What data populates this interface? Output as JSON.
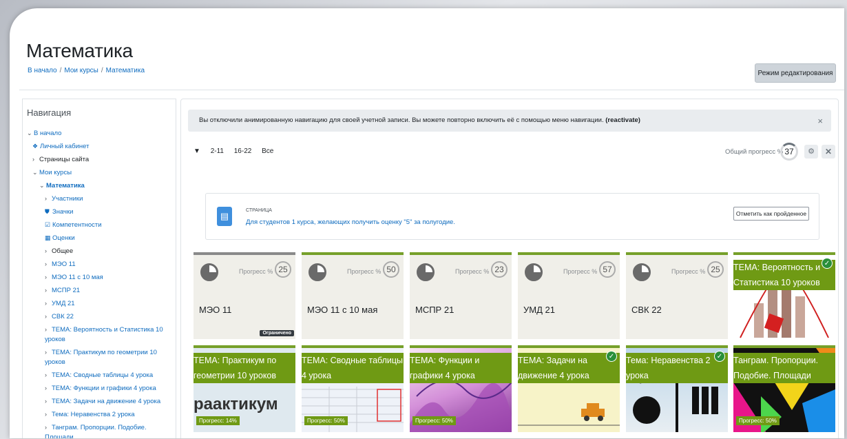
{
  "page_title": "Математика",
  "breadcrumb": [
    "В начало",
    "Мои курсы",
    "Математика"
  ],
  "breadcrumb_sep": "/",
  "edit_button": "Режим редактирования",
  "nav": {
    "title": "Навигация",
    "home": "В начало",
    "dashboard": "Личный кабинет",
    "site_pages": "Страницы сайта",
    "my_courses": "Мои курсы",
    "course": "Математика",
    "participants": "Участники",
    "badges": "Значки",
    "competencies": "Компетентности",
    "grades": "Оценки",
    "sections": [
      "Общее",
      "МЭО 11",
      "МЭО 11 с 10 мая",
      "МСПР 21",
      "УМД 21",
      "СВК 22",
      "ТЕМА: Вероятность и Статистика 10 уроков",
      "ТЕМА: Практикум по геометрии 10 уроков",
      "ТЕМА: Сводные таблицы 4 урока",
      "ТЕМА: Функции и графики 4 урока",
      "ТЕМА: Задачи на движение 4 урока",
      "Тема: Неравенства 2 урока",
      "Танграм. Пропорции. Подобие. Площади"
    ]
  },
  "alert": {
    "text": "Вы отключили анимированную навигацию для своей учетной записи. Вы можете повторно включить её с помощью меню навигации.",
    "link": "(reactivate)",
    "close": "×"
  },
  "filters": [
    "2-11",
    "16-22",
    "Все"
  ],
  "overall": {
    "label": "Общий прогресс %",
    "value": "37"
  },
  "page_activity": {
    "type": "СТРАНИЦА",
    "link": "Для студентов 1 курса, желающих получить оценку \"5\" за полугодие.",
    "button": "Отметить как пройденное"
  },
  "progress_label": "Прогресс %",
  "restricted_label": "Ограничено",
  "tiles_row1": [
    {
      "name": "МЭО 11",
      "progress": "25"
    },
    {
      "name": "МЭО 11 с 10 мая",
      "progress": "50"
    },
    {
      "name": "МСПР 21",
      "progress": "23"
    },
    {
      "name": "УМД 21",
      "progress": "57"
    },
    {
      "name": "СВК 22",
      "progress": "25"
    }
  ],
  "image_tiles": [
    {
      "title": "ТЕМА: Вероятность и Статистика 10 уроков",
      "progress": "",
      "done": true
    },
    {
      "title": "ТЕМА: Практикум по геометрии 10 уроков",
      "progress": "Прогресс: 14%",
      "done": false,
      "art": "раактикум"
    },
    {
      "title": "ТЕМА: Сводные таблицы 4 урока",
      "progress": "Прогресс: 50%",
      "done": false
    },
    {
      "title": "ТЕМА: Функции и графики 4 урока",
      "progress": "Прогресс: 50%",
      "done": false
    },
    {
      "title": "ТЕМА: Задачи на движение 4 урока",
      "progress": "",
      "done": true
    },
    {
      "title": "Тема: Неравенства 2 урока",
      "progress": "",
      "done": true
    },
    {
      "title": "Танграм. Пропорции. Подобие. Площади",
      "progress": "Прогресс: 50%",
      "done": false
    }
  ]
}
